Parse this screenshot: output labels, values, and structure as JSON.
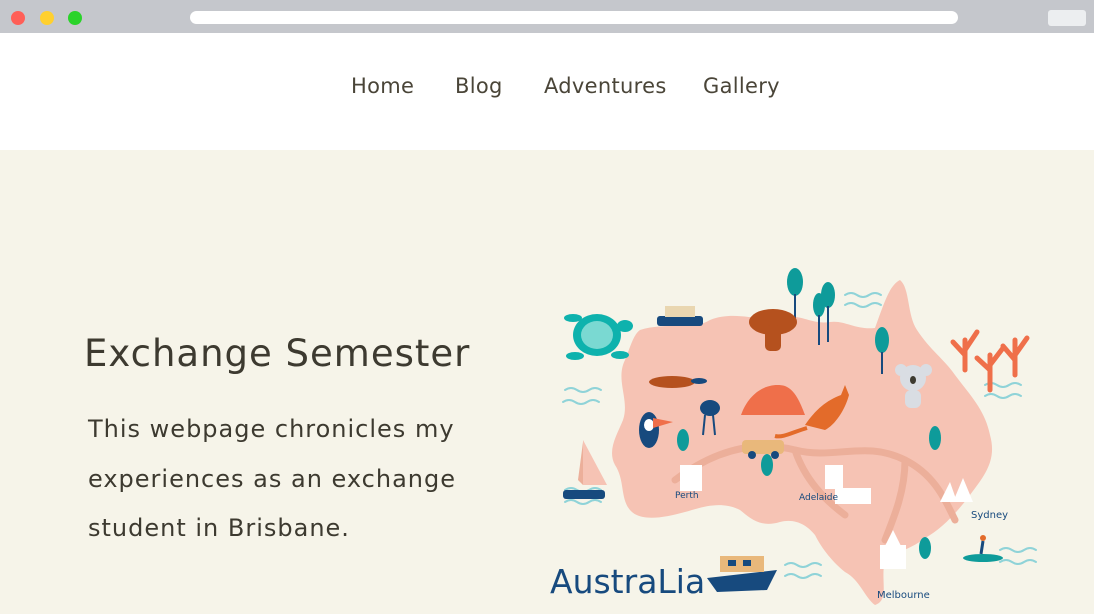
{
  "nav": {
    "items": [
      {
        "label": "Home"
      },
      {
        "label": "Blog"
      },
      {
        "label": "Adventures"
      },
      {
        "label": "Gallery"
      }
    ]
  },
  "hero": {
    "title": "Exchange Semester",
    "description": "This webpage chronicles my experiences as an exchange student in Brisbane."
  },
  "map": {
    "heading": "AustraLia",
    "cities": {
      "perth": "Perth",
      "adelaide": "Adelaide",
      "sydney": "Sydney",
      "melbourne": "Melbourne"
    }
  },
  "colors": {
    "page_bg": "#f6f4e9",
    "text": "#3d3a30",
    "map_land": "#f6c3b4",
    "map_teal": "#0e9b9a",
    "map_navy": "#174a7e",
    "map_coral": "#ef6f4a"
  }
}
